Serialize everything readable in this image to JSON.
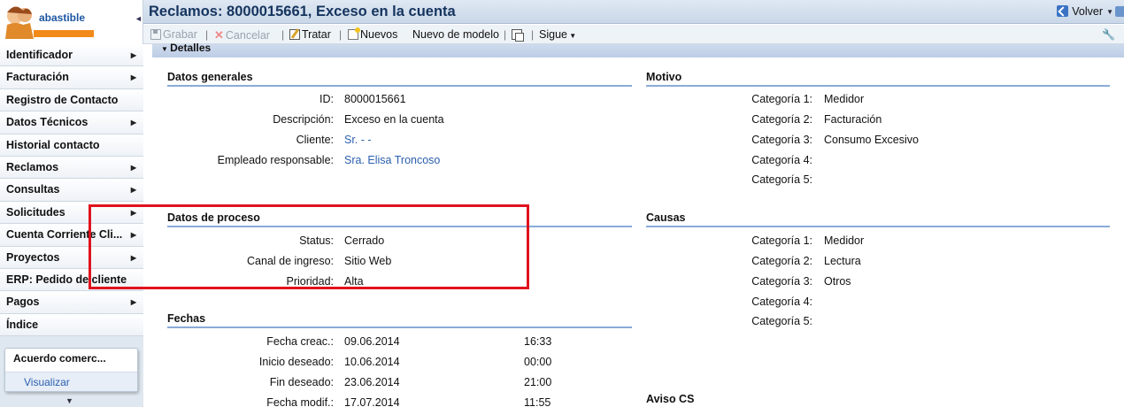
{
  "logo": {
    "text": "abastible"
  },
  "sidebar": {
    "items": [
      {
        "label": "Identificador",
        "arrow": true
      },
      {
        "label": "Facturación",
        "arrow": true
      },
      {
        "label": "Registro de Contacto",
        "arrow": false
      },
      {
        "label": "Datos Técnicos",
        "arrow": true
      },
      {
        "label": "Historial contacto",
        "arrow": false
      },
      {
        "label": "Reclamos",
        "arrow": true
      },
      {
        "label": "Consultas",
        "arrow": true
      },
      {
        "label": "Solicitudes",
        "arrow": true
      },
      {
        "label": "Cuenta Corriente Cli...",
        "arrow": true
      },
      {
        "label": "Proyectos",
        "arrow": true
      },
      {
        "label": "ERP: Pedido de cliente",
        "arrow": false
      },
      {
        "label": "Pagos",
        "arrow": true
      },
      {
        "label": "Índice",
        "arrow": false
      }
    ],
    "quick_panel": {
      "title": "Acuerdo comerc...",
      "link": "Visualizar"
    }
  },
  "header": {
    "title": "Reclamos: 8000015661, Exceso en la cuenta",
    "back_label": "Volver"
  },
  "toolbar": {
    "save": "Grabar",
    "cancel": "Cancelar",
    "process": "Tratar",
    "new": "Nuevos",
    "new_model": "Nuevo de modelo",
    "next": "Sigue"
  },
  "details": {
    "title": "Detalles",
    "general": {
      "title": "Datos generales",
      "id_label": "ID:",
      "id": "8000015661",
      "desc_label": "Descripción:",
      "desc": "Exceso en la cuenta",
      "client_label": "Cliente:",
      "client": "Sr. - -",
      "employee_label": "Empleado responsable:",
      "employee": "Sra. Elisa Troncoso"
    },
    "motivo": {
      "title": "Motivo",
      "cats": [
        {
          "label": "Categoría 1:",
          "value": "Medidor"
        },
        {
          "label": "Categoría 2:",
          "value": "Facturación"
        },
        {
          "label": "Categoría 3:",
          "value": "Consumo Excesivo"
        },
        {
          "label": "Categoría 4:",
          "value": ""
        },
        {
          "label": "Categoría 5:",
          "value": ""
        }
      ]
    },
    "process": {
      "title": "Datos de proceso",
      "status_label": "Status:",
      "status": "Cerrado",
      "channel_label": "Canal de ingreso:",
      "channel": "Sitio Web",
      "priority_label": "Prioridad:",
      "priority": "Alta"
    },
    "causas": {
      "title": "Causas",
      "cats": [
        {
          "label": "Categoría 1:",
          "value": "Medidor"
        },
        {
          "label": "Categoría 2:",
          "value": "Lectura"
        },
        {
          "label": "Categoría 3:",
          "value": "Otros"
        },
        {
          "label": "Categoría 4:",
          "value": ""
        },
        {
          "label": "Categoría 5:",
          "value": ""
        }
      ]
    },
    "dates": {
      "title": "Fechas",
      "rows": [
        {
          "label": "Fecha creac.:",
          "date": "09.06.2014",
          "time": "16:33"
        },
        {
          "label": "Inicio deseado:",
          "date": "10.06.2014",
          "time": "00:00"
        },
        {
          "label": "Fin deseado:",
          "date": "23.06.2014",
          "time": "21:00"
        },
        {
          "label": "Fecha modif.:",
          "date": "17.07.2014",
          "time": "11:55"
        }
      ]
    },
    "aviso": {
      "title": "Aviso CS"
    }
  },
  "colors": {
    "accent": "#2b5fae",
    "highlight": "#e0121d",
    "title": "#15345e"
  }
}
